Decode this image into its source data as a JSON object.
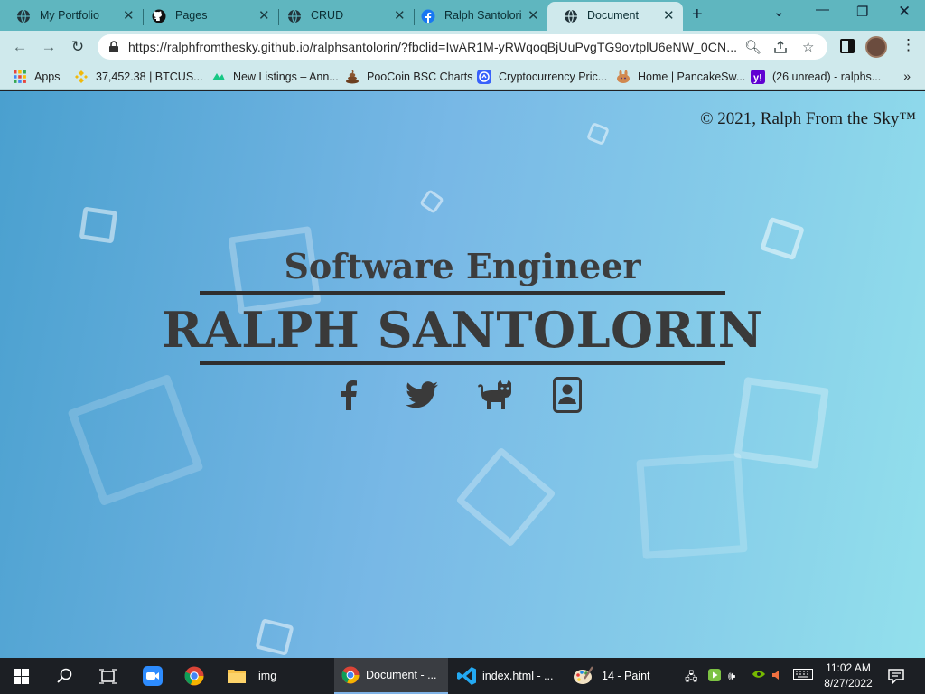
{
  "browser": {
    "tabs": [
      {
        "label": "My Portfolio",
        "icon": "globe-icon"
      },
      {
        "label": "Pages",
        "icon": "github-icon"
      },
      {
        "label": "CRUD",
        "icon": "globe-icon"
      },
      {
        "label": "Ralph Santolorin",
        "icon": "facebook-icon"
      },
      {
        "label": "Document",
        "icon": "globe-icon",
        "active": true
      }
    ],
    "url": "https://ralphfromthesky.github.io/ralphsantolorin/?fbclid=IwAR1M-yRWqoqBjUuPvgTG9ovtplU6eNW_0CN...",
    "bookmarks": [
      {
        "label": "Apps",
        "icon": "apps-grid-icon"
      },
      {
        "label": "37,452.38  |  BTCUS...",
        "icon": "binance-icon"
      },
      {
        "label": "New Listings – Ann...",
        "icon": "coinmarketcap-icon"
      },
      {
        "label": "PooCoin BSC Charts",
        "icon": "poocoin-icon"
      },
      {
        "label": "Cryptocurrency Pric...",
        "icon": "cryptocurrency-icon"
      },
      {
        "label": "Home | PancakeSw...",
        "icon": "pancakeswap-icon"
      },
      {
        "label": "(26 unread) - ralphs...",
        "icon": "yahoo-mail-icon"
      }
    ]
  },
  "page": {
    "copyright": "© 2021, Ralph From the Sky™",
    "subtitle": "Software Engineer",
    "name": "RALPH SANTOLORIN",
    "social_links": [
      "facebook-icon",
      "twitter-icon",
      "github-cat-icon",
      "resume-icon"
    ]
  },
  "taskbar": {
    "apps": [
      {
        "label": "img",
        "icon": "folder-icon"
      },
      {
        "label": "Document - ...",
        "icon": "chrome-icon",
        "active": true
      },
      {
        "label": "index.html - ...",
        "icon": "vscode-icon"
      },
      {
        "label": "14 - Paint",
        "icon": "paint-icon"
      }
    ],
    "time": "11:02 AM",
    "date": "8/27/2022"
  },
  "colors": {
    "tab_strip": "#5fb6bf",
    "toolbar": "#cfe9ec",
    "page_gradient_start": "#4aa0cf",
    "page_gradient_end": "#93e0ec",
    "heading_text": "#3a3a3a",
    "taskbar": "#1c1f24"
  }
}
